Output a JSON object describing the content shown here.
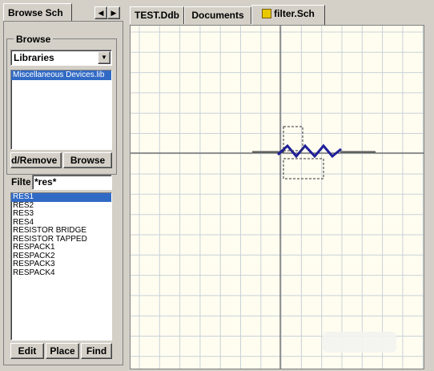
{
  "left_panel": {
    "tab_label": "Browse Sch",
    "group_label": "Browse",
    "library_select": "Libraries",
    "libraries": [
      "Miscellaneous Devices.lib"
    ],
    "add_remove_label": "d/Remove",
    "browse_label": "Browse",
    "filter_label": "Filte",
    "filter_value": "*res*",
    "components": [
      "RES1",
      "RES2",
      "RES3",
      "RES4",
      "RESISTOR BRIDGE",
      "RESISTOR TAPPED",
      "RESPACK1",
      "RESPACK2",
      "RESPACK3",
      "RESPACK4"
    ],
    "selected_component": "RES1",
    "edit_label": "Edit",
    "place_label": "Place",
    "find_label": "Find"
  },
  "tabs": [
    {
      "label": "TEST.Ddb"
    },
    {
      "label": "Documents"
    },
    {
      "label": "filter.Sch",
      "active": true
    }
  ],
  "colors": {
    "grid_line": "#c8d2d8",
    "canvas_bg": "#fffdf0",
    "selection": "#316ac5",
    "resistor": "#1f1f9a"
  }
}
